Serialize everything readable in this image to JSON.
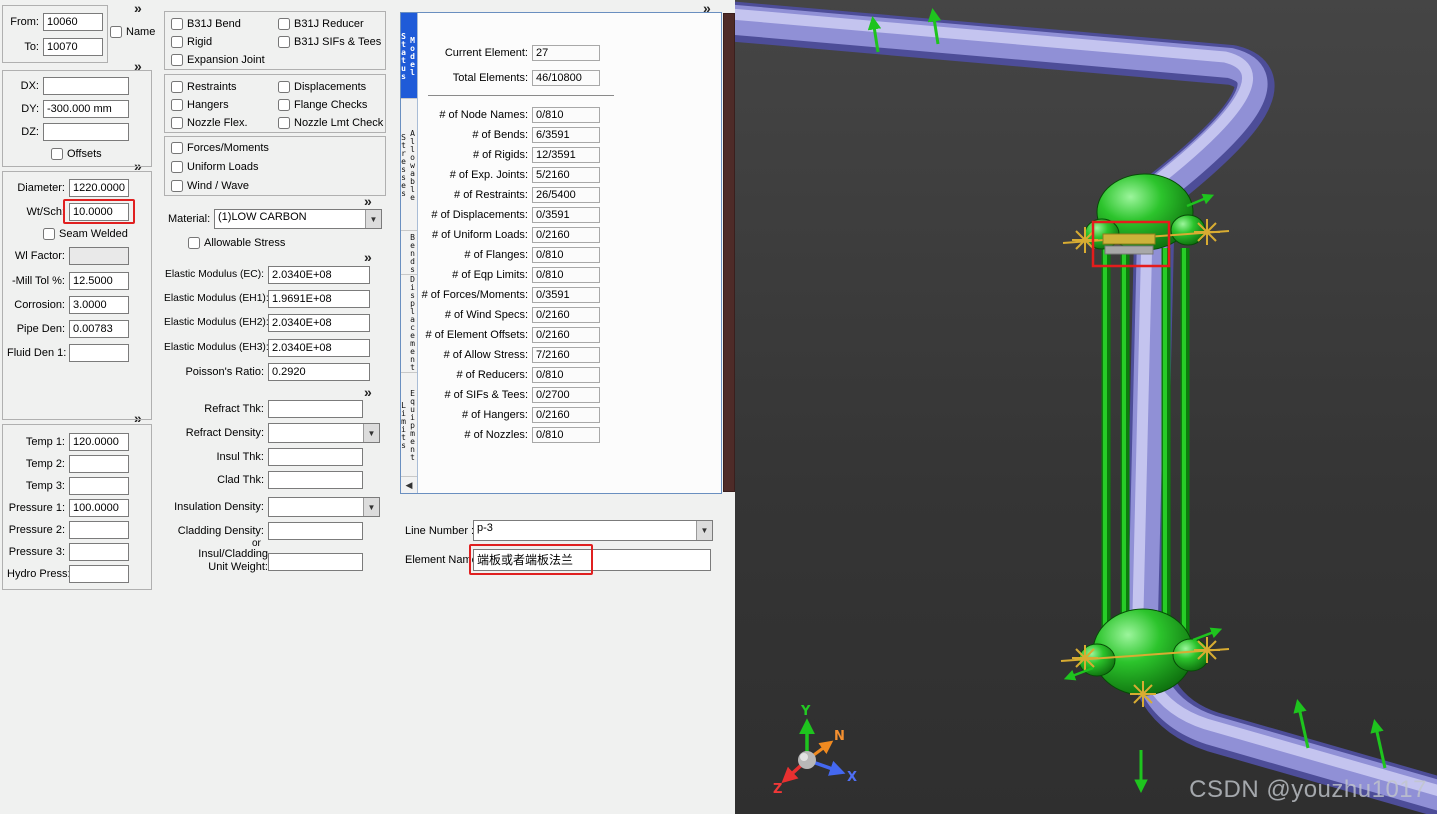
{
  "ui": {
    "chevron": "»",
    "collapse_arrow": "◀",
    "dropdown_arrow": "▼"
  },
  "colors": {
    "highlight_red": "#e02020",
    "active_tab_blue": "#1f5bd8",
    "pipe_blue": "#9090d6",
    "restraint_green": "#1ec41e"
  },
  "node_panel": {
    "from_label": "From:",
    "from_value": "10060",
    "to_label": "To:",
    "to_value": "10070",
    "name_checkbox_label": "Name"
  },
  "delta_panel": {
    "dx_label": "DX:",
    "dx_value": "",
    "dy_label": "DY:",
    "dy_value": "-300.000 mm",
    "dz_label": "DZ:",
    "dz_value": "",
    "offsets_checkbox_label": "Offsets"
  },
  "pipe_panel": {
    "diameter_label": "Diameter:",
    "diameter_value": "1220.0000",
    "wtsch_label": "Wt/Sch:",
    "wtsch_value": "10.0000",
    "seam_welded_checkbox_label": "Seam Welded",
    "wl_factor_label": "Wl Factor:",
    "wl_factor_value": "",
    "mill_tol_label": "-Mill Tol %:",
    "mill_tol_value": "12.5000",
    "corrosion_label": "Corrosion:",
    "corrosion_value": "3.0000",
    "pipe_den_label": "Pipe Den:",
    "pipe_den_value": "0.00783",
    "fluid_den_label": "Fluid Den 1:",
    "fluid_den_value": ""
  },
  "temp_panel": {
    "temp1_label": "Temp 1:",
    "temp1_value": "120.0000",
    "temp2_label": "Temp 2:",
    "temp2_value": "",
    "temp3_label": "Temp 3:",
    "temp3_value": "",
    "pressure1_label": "Pressure 1:",
    "pressure1_value": "100.0000",
    "pressure2_label": "Pressure 2:",
    "pressure2_value": "",
    "pressure3_label": "Pressure 3:",
    "pressure3_value": "",
    "hydro_label": "Hydro Press:",
    "hydro_value": ""
  },
  "element_checks": {
    "group1": {
      "b31j_bend": "B31J Bend",
      "b31j_reducer": "B31J Reducer",
      "rigid": "Rigid",
      "b31j_sifs_tees": "B31J SIFs & Tees",
      "expansion_joint": "Expansion Joint"
    },
    "group2": {
      "restraints": "Restraints",
      "displacements": "Displacements",
      "hangers": "Hangers",
      "flange_checks": "Flange Checks",
      "nozzle_flex": "Nozzle Flex.",
      "nozzle_lmt_check": "Nozzle Lmt Check"
    },
    "group3": {
      "forces_moments": "Forces/Moments",
      "uniform_loads": "Uniform Loads",
      "wind_wave": "Wind / Wave"
    }
  },
  "material_panel": {
    "material_label": "Material:",
    "material_value": "(1)LOW CARBON",
    "allowable_stress_checkbox_label": "Allowable Stress",
    "ec_label": "Elastic Modulus (EC):",
    "ec_value": "2.0340E+08",
    "eh1_label": "Elastic Modulus (EH1):",
    "eh1_value": "1.9691E+08",
    "eh2_label": "Elastic Modulus (EH2):",
    "eh2_value": "2.0340E+08",
    "eh3_label": "Elastic Modulus (EH3):",
    "eh3_value": "2.0340E+08",
    "poisson_label": "Poisson's Ratio:",
    "poisson_value": "0.2920"
  },
  "insulation_panel": {
    "refract_thk_label": "Refract Thk:",
    "refract_thk_value": "",
    "refract_density_label": "Refract Density:",
    "refract_density_value": "",
    "insul_thk_label": "Insul Thk:",
    "insul_thk_value": "",
    "clad_thk_label": "Clad Thk:",
    "clad_thk_value": "",
    "insulation_density_label": "Insulation Density:",
    "insulation_density_value": "",
    "cladding_density_label": "Cladding Density:",
    "cladding_density_value": "",
    "or_label": "or",
    "insul_cladding_label_line1": "Insul/Cladding",
    "insul_cladding_label_line2": "Unit Weight:",
    "insul_cladding_value": ""
  },
  "model_status": {
    "tabs": [
      {
        "label": "Model Status",
        "active": true
      },
      {
        "label": "Allowable Stresses",
        "active": false
      },
      {
        "label": "Bends",
        "active": false
      },
      {
        "label": "Displacements",
        "active": false
      },
      {
        "label": "Equipment Limits",
        "active": false
      }
    ],
    "current_element_label": "Current Element:",
    "current_element_value": "27",
    "total_elements_label": "Total Elements:",
    "total_elements_value": "46/10800",
    "rows": [
      {
        "label": "# of Node Names:",
        "value": "0/810"
      },
      {
        "label": "# of Bends:",
        "value": "6/3591"
      },
      {
        "label": "# of Rigids:",
        "value": "12/3591"
      },
      {
        "label": "# of Exp. Joints:",
        "value": "5/2160"
      },
      {
        "label": "# of Restraints:",
        "value": "26/5400"
      },
      {
        "label": "# of Displacements:",
        "value": "0/3591"
      },
      {
        "label": "# of Uniform Loads:",
        "value": "0/2160"
      },
      {
        "label": "# of Flanges:",
        "value": "0/810"
      },
      {
        "label": "# of Eqp Limits:",
        "value": "0/810"
      },
      {
        "label": "# of Forces/Moments:",
        "value": "0/3591"
      },
      {
        "label": "# of Wind Specs:",
        "value": "0/2160"
      },
      {
        "label": "# of Element Offsets:",
        "value": "0/2160"
      },
      {
        "label": "# of Allow Stress:",
        "value": "7/2160"
      },
      {
        "label": "# of Reducers:",
        "value": "0/810"
      },
      {
        "label": "# of SIFs & Tees:",
        "value": "0/2700"
      },
      {
        "label": "# of Hangers:",
        "value": "0/2160"
      },
      {
        "label": "# of Nozzles:",
        "value": "0/810"
      }
    ]
  },
  "line_panel": {
    "line_number_label": "Line Number :",
    "line_number_value": "p-3",
    "element_name_label": "Element Name",
    "element_name_value": "端板或者端板法兰"
  },
  "viewport": {
    "watermark": "CSDN @youzhu1017",
    "axis_x": "X",
    "axis_y": "Y",
    "axis_z": "Z",
    "axis_n": "N"
  }
}
